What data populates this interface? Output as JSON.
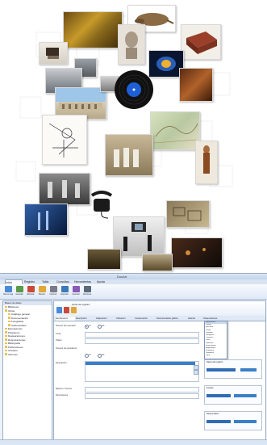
{
  "collage": {
    "description_icons": [
      "vinyl-record",
      "telephone",
      "film-camera"
    ]
  },
  "app": {
    "title": "DocArt",
    "ribbon_tabs": [
      "Inicio",
      "Registro",
      "Tabla",
      "Consultas",
      "Herramientas",
      "Ayuda"
    ],
    "ribbon_buttons": [
      "Nuevo registro",
      "Guardar",
      "Eliminar",
      "Buscar",
      "Imprimir",
      "Exportar",
      "Importar",
      "Opciones"
    ],
    "sidebar": {
      "header": "Bases de datos",
      "items": [
        "Biblioteca",
        "Obras",
        "Catálogo general",
        "Documentación",
        "Fotografías",
        "Audiovisuales",
        "Exposiciones",
        "Préstamos",
        "Restauraciones",
        "Reproducciones",
        "Bibliografía",
        "Publicaciones",
        "Usuarios",
        "Informes"
      ]
    },
    "document": {
      "title": "Ficha de registro"
    },
    "tabs": [
      "Identificación",
      "Descripción",
      "Adquisición",
      "Ubicación",
      "Conservación",
      "Documentación gráfica",
      "Historia",
      "Observaciones"
    ],
    "form": {
      "rows": [
        {
          "label": "Número de inventario",
          "value": ""
        },
        {
          "label": "Título",
          "value": ""
        },
        {
          "label": "Objeto",
          "value": ""
        },
        {
          "label": "Número de expediente",
          "value": ""
        }
      ],
      "radio_1": [
        "Sí",
        "No"
      ],
      "radio_2": [
        "Sí",
        "No"
      ],
      "textarea_label": "Descripción",
      "extra_rows": [
        {
          "label": "Materia / Técnica",
          "value": ""
        },
        {
          "label": "Dimensiones",
          "value": ""
        }
      ]
    },
    "dropdown": [
      "Seleccionar...",
      "Pintura",
      "Escultura",
      "Dibujo",
      "Grabado",
      "Fotografía",
      "Cerámica",
      "Textil",
      "Mobiliario",
      "Numismática",
      "Arqueología",
      "Etnografía",
      "Orfebrería",
      "Vidrio"
    ],
    "right_panel": {
      "boxes": [
        "Datos del registro",
        "Fechas",
        "Responsable"
      ]
    },
    "colors": {
      "accent": "#2f6cb4",
      "selection": "#3b7fc6"
    }
  }
}
